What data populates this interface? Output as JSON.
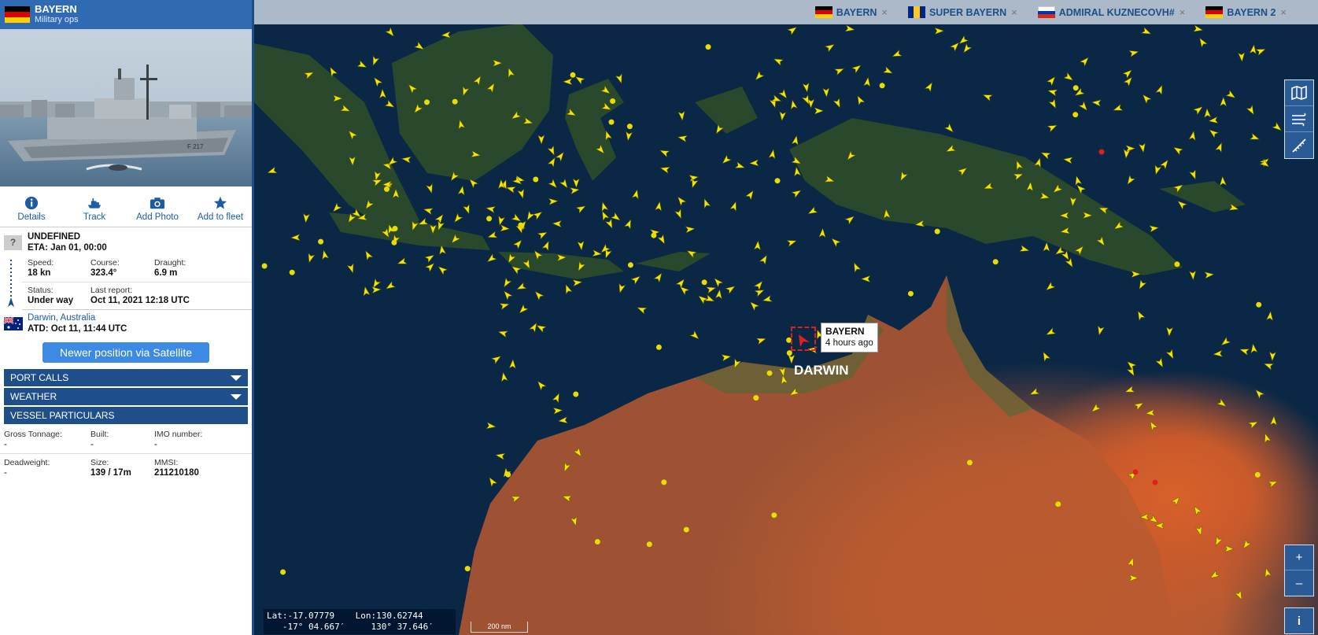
{
  "vessel": {
    "name": "BAYERN",
    "type": "Military ops",
    "photo_hull_text": "F 217"
  },
  "actions": [
    {
      "label": "Details",
      "icon": "info-icon"
    },
    {
      "label": "Track",
      "icon": "ship-icon"
    },
    {
      "label": "Add Photo",
      "icon": "camera-icon"
    },
    {
      "label": "Add to fleet",
      "icon": "star-icon"
    }
  ],
  "destination": {
    "unknown_mark": "?",
    "name": "UNDEFINED",
    "eta": "ETA: Jan 01, 00:00"
  },
  "voyage": {
    "speed_label": "Speed:",
    "speed": "18 kn",
    "course_label": "Course:",
    "course": "323.4°",
    "draught_label": "Draught:",
    "draught": "6.9 m",
    "status_label": "Status:",
    "status": "Under way",
    "last_report_label": "Last report:",
    "last_report": "Oct 11, 2021 12:18 UTC"
  },
  "departure": {
    "port": "Darwin, Australia",
    "atd": "ATD: Oct 11, 11:44 UTC"
  },
  "satellite_button": "Newer position via Satellite",
  "sections": {
    "port_calls": "PORT CALLS",
    "weather": "WEATHER",
    "particulars": "VESSEL PARTICULARS"
  },
  "particulars": {
    "gross_label": "Gross Tonnage:",
    "gross": "-",
    "built_label": "Built:",
    "built": "-",
    "imo_label": "IMO number:",
    "imo": "-",
    "deadweight_label": "Deadweight:",
    "deadweight": "-",
    "size_label": "Size:",
    "size": "139 / 17m",
    "mmsi_label": "MMSI:",
    "mmsi": "211210180"
  },
  "tabs": [
    {
      "label": "BAYERN",
      "flag": "germany"
    },
    {
      "label": "SUPER BAYERN",
      "flag": "barbados"
    },
    {
      "label": "ADMIRAL KUZNECOVH#",
      "flag": "russia"
    },
    {
      "label": "BAYERN 2",
      "flag": "germany"
    }
  ],
  "tab_close": "×",
  "map": {
    "popup_name": "BAYERN",
    "popup_time": "4 hours ago",
    "city_label": "DARWIN",
    "coords_line1": "Lat:-17.07779    Lon:130.62744",
    "coords_line2": "   -17° 04.667′     130° 37.646′",
    "scale_label": "200 nm",
    "zoom_in": "+",
    "zoom_out": "–",
    "info": "i"
  },
  "colors": {
    "header_blue": "#2f6ab3",
    "section_blue": "#1e4f8b",
    "link_blue": "#1d5ba7",
    "vessel_marker": "#f2e600",
    "selected_marker": "#e02020"
  }
}
